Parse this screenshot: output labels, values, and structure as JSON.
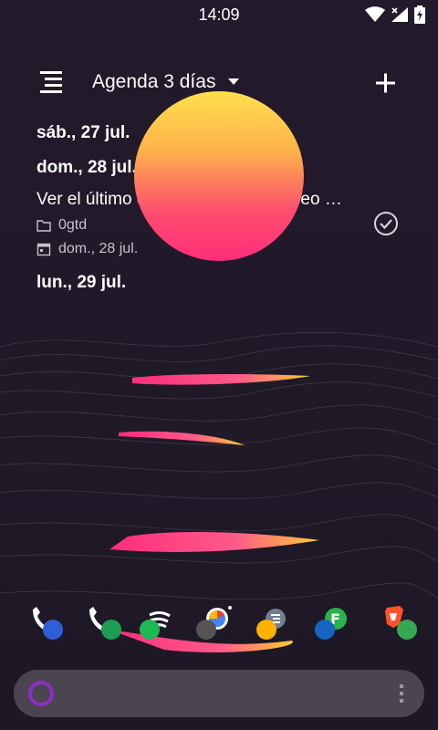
{
  "status_bar": {
    "time": "14:09",
    "icons": [
      "wifi-icon",
      "signal-icon",
      "battery-charging-icon"
    ]
  },
  "widget": {
    "title": "Agenda 3 días",
    "menu_icon": "hamburger-menu-icon",
    "add_icon": "plus-icon"
  },
  "agenda": {
    "days": [
      {
        "label": "sáb., 27 jul.",
        "tasks": []
      },
      {
        "label": "dom., 28 jul.",
        "tasks": [
          {
            "title": "Ver el último capitulo de Vento Aureo …",
            "project": "0gtd",
            "date": "dom., 28 jul.",
            "done_icon": "check-circle-icon"
          }
        ]
      },
      {
        "label": "lun., 29 jul.",
        "tasks": []
      }
    ]
  },
  "dock": {
    "apps": [
      {
        "name": "phone-dialer-contact-icon",
        "colors": [
          "#ffffff",
          "#2f5fd6"
        ]
      },
      {
        "name": "phone-call-icon",
        "colors": [
          "#ffffff",
          "#1e9e54"
        ]
      },
      {
        "name": "spotify-icon",
        "colors": [
          "#1db954"
        ]
      },
      {
        "name": "chrome-icon",
        "colors": [
          "#4285f4",
          "#555555"
        ]
      },
      {
        "name": "tasks-app-icon",
        "colors": [
          "#708090",
          "#ffb300"
        ]
      },
      {
        "name": "feedly-icon",
        "colors": [
          "#2bb24c",
          "#1565c0"
        ]
      },
      {
        "name": "brave-browser-icon",
        "colors": [
          "#fb542b",
          "#34a853"
        ]
      }
    ]
  },
  "search_bar": {
    "logo_icon": "cortana-ring-icon",
    "menu_icon": "vertical-dots-icon",
    "accent": "#8c2fc9"
  },
  "colors": {
    "background": "#241a2c",
    "sun_top": "#ffe04e",
    "sun_bottom": "#ff2d7a",
    "streak_pink": "#ff3d8b",
    "streak_yellow": "#ffcc33"
  }
}
